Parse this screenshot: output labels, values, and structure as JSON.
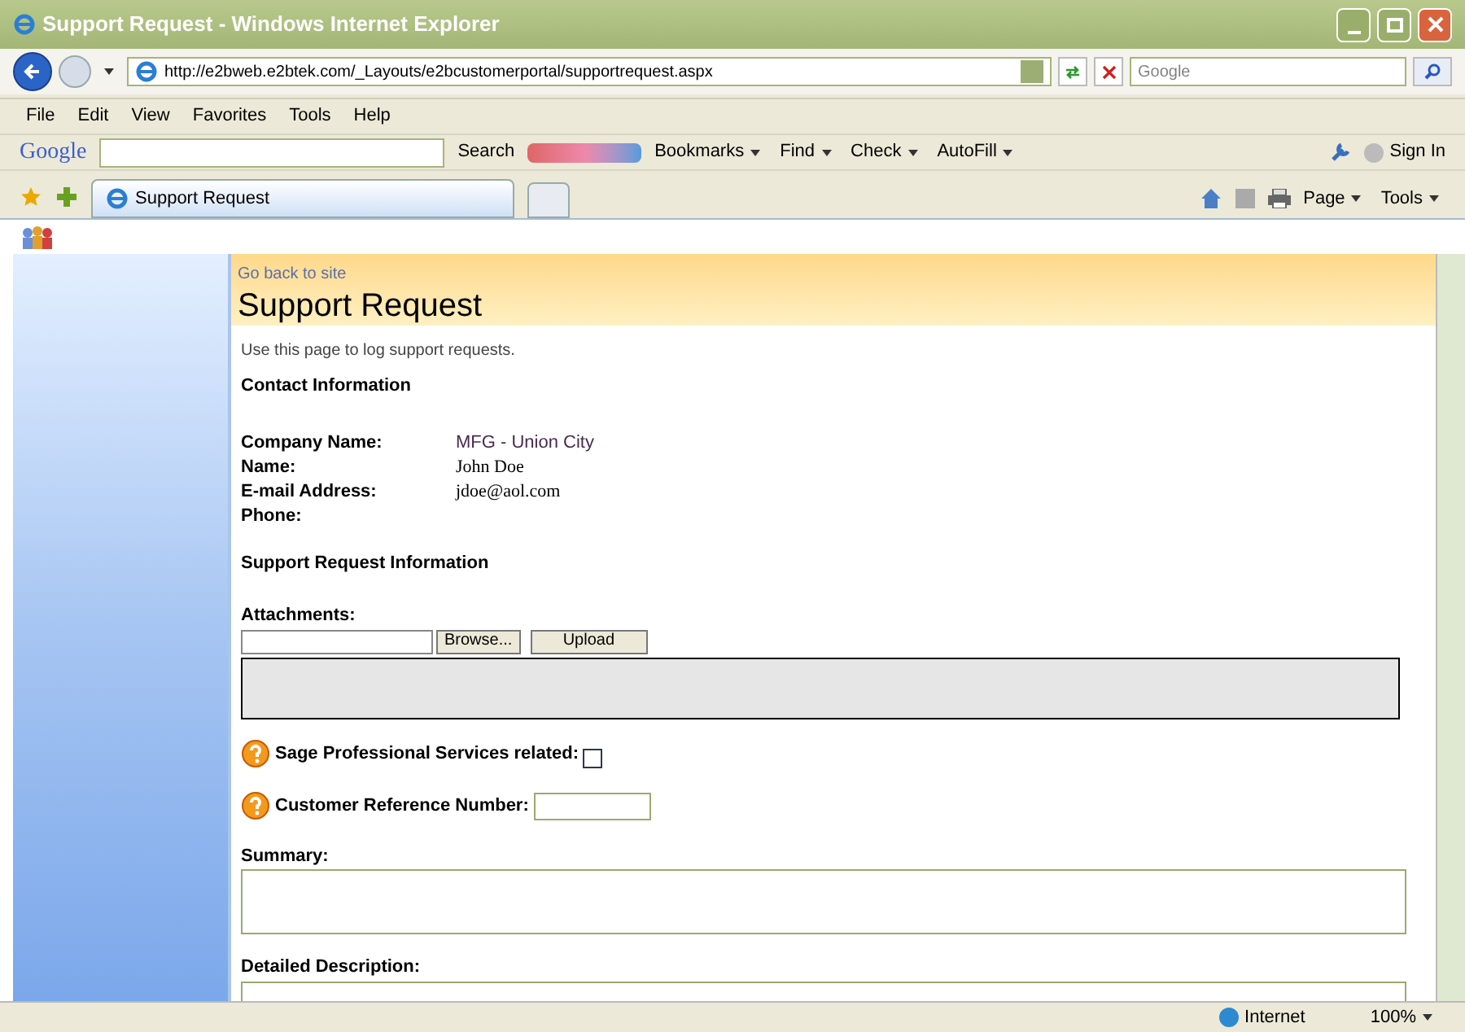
{
  "window": {
    "title": "Support Request - Windows Internet Explorer"
  },
  "address_bar": {
    "url": "http://e2bweb.e2btek.com/_Layouts/e2bcustomerportal/supportrequest.aspx"
  },
  "search_box": {
    "placeholder": "Google"
  },
  "menu": [
    "File",
    "Edit",
    "View",
    "Favorites",
    "Tools",
    "Help"
  ],
  "google_toolbar": {
    "logo": "Google",
    "search_label": "Search",
    "items": [
      "Bookmarks",
      "Find",
      "Check",
      "AutoFill"
    ],
    "sign_in": "Sign In"
  },
  "tabs": [
    {
      "label": "Support Request",
      "selected": true
    }
  ],
  "command_bar": [
    "Page",
    "Tools"
  ],
  "page": {
    "back_link": "Go back to site",
    "title": "Support Request",
    "intro": "Use this page to log support requests.",
    "contact_heading": "Contact Information",
    "contact_fields": [
      {
        "label": "Company Name:",
        "value": "MFG - Union City"
      },
      {
        "label": "Name:",
        "value": "John Doe"
      },
      {
        "label": "E-mail Address:",
        "value": "jdoe@aol.com"
      },
      {
        "label": "Phone:"
      }
    ],
    "request_heading": "Support Request Information",
    "attachments_label": "Attachments:",
    "browse_button": "Browse...",
    "upload_button": "Upload",
    "sage_label": "Sage Professional Services related:",
    "sage_checked": false,
    "reference_label": "Customer Reference Number:",
    "summary_label": "Summary:",
    "description_label": "Detailed Description:"
  },
  "status_bar": {
    "zone": "Internet",
    "zoom": "100%"
  }
}
